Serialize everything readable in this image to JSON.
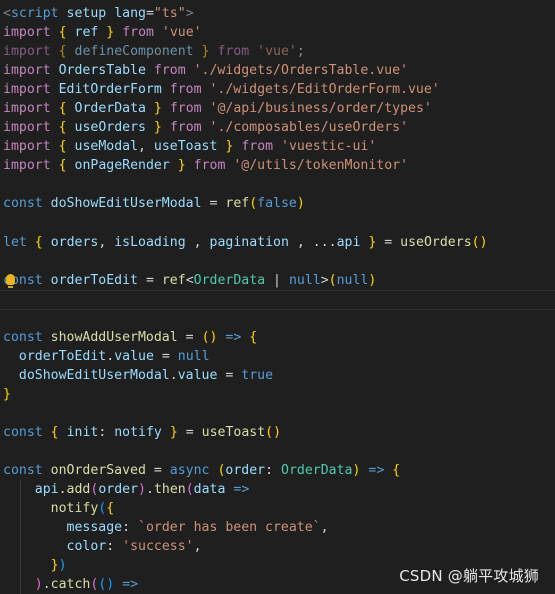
{
  "colors": {
    "background": "#1f1f1f",
    "keyword": "#569cd6",
    "control": "#c586c0",
    "variable": "#9cdcfe",
    "function": "#dcdcaa",
    "string": "#ce9178",
    "type": "#4ec9b0",
    "tag": "#808080",
    "plain": "#d4d4d4",
    "bracket1": "#ffd700",
    "bracket2": "#da70d6",
    "bracket3": "#179fff"
  },
  "editor": {
    "lines": [
      [
        [
          "<",
          "g"
        ],
        [
          "script",
          "kw"
        ],
        [
          " ",
          "p"
        ],
        [
          "setup",
          "v"
        ],
        [
          " ",
          "p"
        ],
        [
          "lang",
          "v"
        ],
        [
          "=",
          "p"
        ],
        [
          "\"ts\"",
          "s"
        ],
        [
          ">",
          "g"
        ]
      ],
      [
        [
          "import",
          "c"
        ],
        [
          " ",
          "p"
        ],
        [
          "{",
          "b1"
        ],
        [
          " ",
          "p"
        ],
        [
          "ref",
          "v"
        ],
        [
          " ",
          "p"
        ],
        [
          "}",
          "b1"
        ],
        [
          " ",
          "p"
        ],
        [
          "from",
          "c"
        ],
        [
          " ",
          "p"
        ],
        [
          "'vue'",
          "s"
        ]
      ],
      [
        [
          "import",
          "c_dim"
        ],
        [
          " ",
          "p"
        ],
        [
          "{",
          "b1_dim"
        ],
        [
          " ",
          "p"
        ],
        [
          "defineComponent",
          "v_dim"
        ],
        [
          " ",
          "p"
        ],
        [
          "}",
          "b1_dim"
        ],
        [
          " ",
          "p"
        ],
        [
          "from",
          "c_dim"
        ],
        [
          " ",
          "p"
        ],
        [
          "'vue'",
          "s_dim"
        ],
        [
          ";",
          "p_dim"
        ]
      ],
      [
        [
          "import",
          "c"
        ],
        [
          " ",
          "p"
        ],
        [
          "OrdersTable",
          "v"
        ],
        [
          " ",
          "p"
        ],
        [
          "from",
          "c"
        ],
        [
          " ",
          "p"
        ],
        [
          "'./widgets/OrdersTable.vue'",
          "s"
        ]
      ],
      [
        [
          "import",
          "c"
        ],
        [
          " ",
          "p"
        ],
        [
          "EditOrderForm",
          "v"
        ],
        [
          " ",
          "p"
        ],
        [
          "from",
          "c"
        ],
        [
          " ",
          "p"
        ],
        [
          "'./widgets/EditOrderForm.vue'",
          "s"
        ]
      ],
      [
        [
          "import",
          "c"
        ],
        [
          " ",
          "p"
        ],
        [
          "{",
          "b1"
        ],
        [
          " ",
          "p"
        ],
        [
          "OrderData",
          "v"
        ],
        [
          " ",
          "p"
        ],
        [
          "}",
          "b1"
        ],
        [
          " ",
          "p"
        ],
        [
          "from",
          "c"
        ],
        [
          " ",
          "p"
        ],
        [
          "'@/api/business/order/types'",
          "s"
        ]
      ],
      [
        [
          "import",
          "c"
        ],
        [
          " ",
          "p"
        ],
        [
          "{",
          "b1"
        ],
        [
          " ",
          "p"
        ],
        [
          "useOrders",
          "v"
        ],
        [
          " ",
          "p"
        ],
        [
          "}",
          "b1"
        ],
        [
          " ",
          "p"
        ],
        [
          "from",
          "c"
        ],
        [
          " ",
          "p"
        ],
        [
          "'./composables/useOrders'",
          "s"
        ]
      ],
      [
        [
          "import",
          "c"
        ],
        [
          " ",
          "p"
        ],
        [
          "{",
          "b1"
        ],
        [
          " ",
          "p"
        ],
        [
          "useModal",
          "v"
        ],
        [
          ", ",
          "p"
        ],
        [
          "useToast",
          "v"
        ],
        [
          " ",
          "p"
        ],
        [
          "}",
          "b1"
        ],
        [
          " ",
          "p"
        ],
        [
          "from",
          "c"
        ],
        [
          " ",
          "p"
        ],
        [
          "'vuestic-ui'",
          "s"
        ]
      ],
      [
        [
          "import",
          "c"
        ],
        [
          " ",
          "p"
        ],
        [
          "{",
          "b1"
        ],
        [
          " ",
          "p"
        ],
        [
          "onPageRender",
          "v"
        ],
        [
          " ",
          "p"
        ],
        [
          "}",
          "b1"
        ],
        [
          " ",
          "p"
        ],
        [
          "from",
          "c"
        ],
        [
          " ",
          "p"
        ],
        [
          "'@/utils/tokenMonitor'",
          "s"
        ]
      ],
      [],
      [
        [
          "const",
          "kw"
        ],
        [
          " ",
          "p"
        ],
        [
          "doShowEditUserModal",
          "v"
        ],
        [
          " ",
          "p"
        ],
        [
          "=",
          "p"
        ],
        [
          " ",
          "p"
        ],
        [
          "ref",
          "f"
        ],
        [
          "(",
          "b1"
        ],
        [
          "false",
          "kw"
        ],
        [
          ")",
          "b1"
        ]
      ],
      [],
      [
        [
          "let",
          "kw"
        ],
        [
          " ",
          "p"
        ],
        [
          "{",
          "b1"
        ],
        [
          " ",
          "p"
        ],
        [
          "orders",
          "v"
        ],
        [
          ", ",
          "p"
        ],
        [
          "isLoading",
          "v"
        ],
        [
          " , ",
          "p"
        ],
        [
          "pagination",
          "v"
        ],
        [
          " , ",
          "p"
        ],
        [
          "...",
          "p"
        ],
        [
          "api",
          "v"
        ],
        [
          " ",
          "p"
        ],
        [
          "}",
          "b1"
        ],
        [
          " ",
          "p"
        ],
        [
          "=",
          "p"
        ],
        [
          " ",
          "p"
        ],
        [
          "useOrders",
          "f"
        ],
        [
          "(",
          "b1"
        ],
        [
          ")",
          "b1"
        ]
      ],
      [],
      [
        [
          "const",
          "kw"
        ],
        [
          " ",
          "p"
        ],
        [
          "orderToEdit",
          "v"
        ],
        [
          " ",
          "p"
        ],
        [
          "=",
          "p"
        ],
        [
          " ",
          "p"
        ],
        [
          "ref",
          "f"
        ],
        [
          "<",
          "p"
        ],
        [
          "OrderData",
          "t"
        ],
        [
          " | ",
          "p"
        ],
        [
          "null",
          "kw"
        ],
        [
          ">",
          "p"
        ],
        [
          "(",
          "b1"
        ],
        [
          "null",
          "kw"
        ],
        [
          ")",
          "b1"
        ]
      ],
      [],
      [],
      [
        [
          "const",
          "kw"
        ],
        [
          " ",
          "p"
        ],
        [
          "showAddUserModal",
          "f"
        ],
        [
          " ",
          "p"
        ],
        [
          "=",
          "p"
        ],
        [
          " ",
          "p"
        ],
        [
          "(",
          "b1"
        ],
        [
          ")",
          "b1"
        ],
        [
          " ",
          "p"
        ],
        [
          "=>",
          "kw"
        ],
        [
          " ",
          "p"
        ],
        [
          "{",
          "b1"
        ]
      ],
      [
        [
          "  ",
          "p"
        ],
        [
          "orderToEdit",
          "v"
        ],
        [
          ".",
          "p"
        ],
        [
          "value",
          "v"
        ],
        [
          " ",
          "p"
        ],
        [
          "=",
          "p"
        ],
        [
          " ",
          "p"
        ],
        [
          "null",
          "kw"
        ]
      ],
      [
        [
          "  ",
          "p"
        ],
        [
          "doShowEditUserModal",
          "v"
        ],
        [
          ".",
          "p"
        ],
        [
          "value",
          "v"
        ],
        [
          " ",
          "p"
        ],
        [
          "=",
          "p"
        ],
        [
          " ",
          "p"
        ],
        [
          "true",
          "kw"
        ]
      ],
      [
        [
          "}",
          "b1"
        ]
      ],
      [],
      [
        [
          "const",
          "kw"
        ],
        [
          " ",
          "p"
        ],
        [
          "{",
          "b1"
        ],
        [
          " ",
          "p"
        ],
        [
          "init",
          "v"
        ],
        [
          ": ",
          "p"
        ],
        [
          "notify",
          "v"
        ],
        [
          " ",
          "p"
        ],
        [
          "}",
          "b1"
        ],
        [
          " ",
          "p"
        ],
        [
          "=",
          "p"
        ],
        [
          " ",
          "p"
        ],
        [
          "useToast",
          "f"
        ],
        [
          "(",
          "b1"
        ],
        [
          ")",
          "b1"
        ]
      ],
      [],
      [
        [
          "const",
          "kw"
        ],
        [
          " ",
          "p"
        ],
        [
          "onOrderSaved",
          "f"
        ],
        [
          " ",
          "p"
        ],
        [
          "=",
          "p"
        ],
        [
          " ",
          "p"
        ],
        [
          "async",
          "kw"
        ],
        [
          " ",
          "p"
        ],
        [
          "(",
          "b1"
        ],
        [
          "order",
          "v"
        ],
        [
          ": ",
          "p"
        ],
        [
          "OrderData",
          "t"
        ],
        [
          ")",
          "b1"
        ],
        [
          " ",
          "p"
        ],
        [
          "=>",
          "kw"
        ],
        [
          " ",
          "p"
        ],
        [
          "{",
          "b1"
        ]
      ],
      [
        [
          "    ",
          "p"
        ],
        [
          "api",
          "v"
        ],
        [
          ".",
          "p"
        ],
        [
          "add",
          "f"
        ],
        [
          "(",
          "b2"
        ],
        [
          "order",
          "v"
        ],
        [
          ")",
          "b2"
        ],
        [
          ".",
          "p"
        ],
        [
          "then",
          "f"
        ],
        [
          "(",
          "b2"
        ],
        [
          "data",
          "v"
        ],
        [
          " ",
          "p"
        ],
        [
          "=>",
          "kw"
        ]
      ],
      [
        [
          "      ",
          "p"
        ],
        [
          "notify",
          "f"
        ],
        [
          "(",
          "b3"
        ],
        [
          "{",
          "b1"
        ]
      ],
      [
        [
          "        ",
          "p"
        ],
        [
          "message",
          "v"
        ],
        [
          ": ",
          "p"
        ],
        [
          "`order has been create`",
          "s"
        ],
        [
          ",",
          "p"
        ]
      ],
      [
        [
          "        ",
          "p"
        ],
        [
          "color",
          "v"
        ],
        [
          ": ",
          "p"
        ],
        [
          "'success'",
          "s"
        ],
        [
          ",",
          "p"
        ]
      ],
      [
        [
          "      ",
          "p"
        ],
        [
          "}",
          "b1"
        ],
        [
          ")",
          "b3"
        ]
      ],
      [
        [
          "    ",
          "p"
        ],
        [
          ")",
          "b2"
        ],
        [
          ".",
          "p"
        ],
        [
          "catch",
          "f"
        ],
        [
          "(",
          "b2"
        ],
        [
          "(",
          "b3"
        ],
        [
          ")",
          "b3"
        ],
        [
          " ",
          "p"
        ],
        [
          "=>",
          "kw"
        ]
      ]
    ]
  },
  "watermark": "CSDN @躺平攻城狮"
}
